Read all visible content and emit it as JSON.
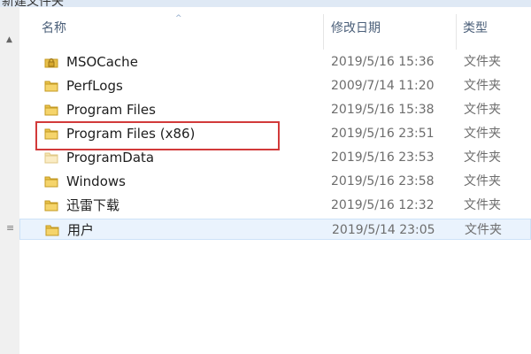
{
  "window": {
    "title_partial": "新建文件夹"
  },
  "columns": {
    "name": "名称",
    "date": "修改日期",
    "type": "类型"
  },
  "rows": [
    {
      "name": "MSOCache",
      "date": "2019/5/16 15:36",
      "type": "文件夹",
      "icon": "locked-folder-icon"
    },
    {
      "name": "PerfLogs",
      "date": "2009/7/14 11:20",
      "type": "文件夹",
      "icon": "folder-icon"
    },
    {
      "name": "Program Files",
      "date": "2019/5/16 15:38",
      "type": "文件夹",
      "icon": "folder-icon"
    },
    {
      "name": "Program Files (x86)",
      "date": "2019/5/16 23:51",
      "type": "文件夹",
      "icon": "folder-icon"
    },
    {
      "name": "ProgramData",
      "date": "2019/5/16 23:53",
      "type": "文件夹",
      "icon": "faded-folder-icon"
    },
    {
      "name": "Windows",
      "date": "2019/5/16 23:58",
      "type": "文件夹",
      "icon": "folder-icon"
    },
    {
      "name": "迅雷下载",
      "date": "2019/5/16 12:32",
      "type": "文件夹",
      "icon": "folder-icon"
    },
    {
      "name": "用户",
      "date": "2019/5/14 23:05",
      "type": "文件夹",
      "icon": "folder-icon"
    }
  ],
  "colors": {
    "header_text": "#4c607a",
    "selection": "#eaf3fd",
    "annotation": "#d23a3a"
  }
}
